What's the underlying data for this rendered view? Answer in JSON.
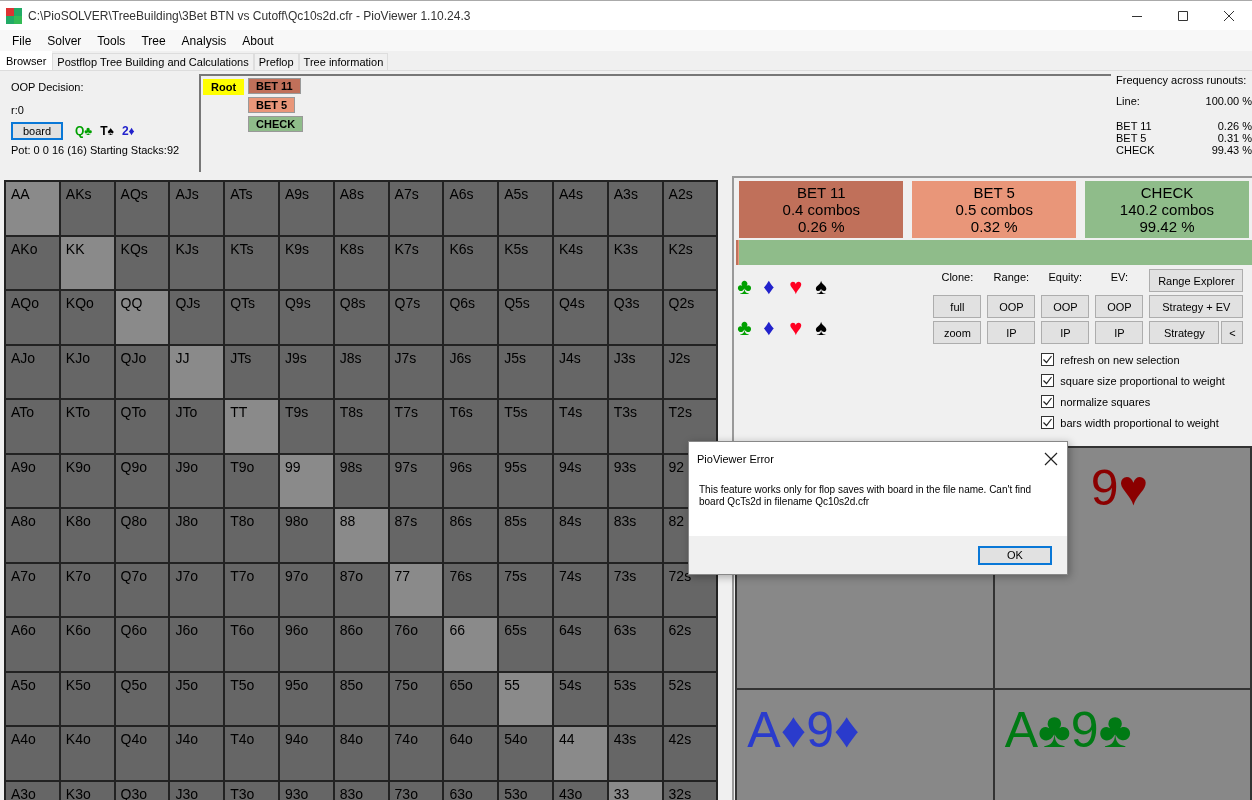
{
  "window": {
    "title": "C:\\PioSOLVER\\TreeBuilding\\3Bet BTN vs Cutoff\\Qc10s2d.cfr - PioViewer 1.10.24.3"
  },
  "menu": [
    "File",
    "Solver",
    "Tools",
    "Tree",
    "Analysis",
    "About"
  ],
  "tabs": [
    {
      "label": "Browser",
      "selected": true
    },
    {
      "label": "Postflop Tree Building and Calculations",
      "selected": false
    },
    {
      "label": "Preflop",
      "selected": false
    },
    {
      "label": "Tree information",
      "selected": false
    }
  ],
  "info": {
    "decision": "OOP Decision:",
    "node": "r:0",
    "board_button": "board",
    "board": [
      {
        "label": "Q♣",
        "color": "#00a000"
      },
      {
        "label": "T♠",
        "color": "#000000"
      },
      {
        "label": "2♦",
        "color": "#2222cc"
      }
    ],
    "pot": "Pot: 0 0 16 (16) Starting Stacks:92"
  },
  "tree": {
    "label": "Root",
    "color": "#ffff00",
    "children": [
      {
        "label": "BET 11",
        "color": "#c0705a"
      },
      {
        "label": "BET 5",
        "color": "#e99679"
      },
      {
        "label": "CHECK",
        "color": "#8fbc8a"
      }
    ]
  },
  "frequency": {
    "title": "Frequency across runouts:",
    "line_label": "Line:",
    "line_value": "100.00 %",
    "rows": [
      {
        "label": "BET 11",
        "value": "0.26 %"
      },
      {
        "label": "BET 5",
        "value": "0.31 %"
      },
      {
        "label": "CHECK",
        "value": "99.43 %"
      }
    ]
  },
  "grid": {
    "rows": [
      [
        {
          "label": "AA",
          "kind": "pair"
        },
        {
          "label": "AKs",
          "kind": "hand"
        },
        {
          "label": "AQs",
          "kind": "hand"
        },
        {
          "label": "AJs",
          "kind": "hand"
        },
        {
          "label": "ATs",
          "kind": "hand"
        },
        {
          "label": "A9s",
          "kind": "hand"
        },
        {
          "label": "A8s",
          "kind": "hand"
        },
        {
          "label": "A7s",
          "kind": "hand"
        },
        {
          "label": "A6s",
          "kind": "hand"
        },
        {
          "label": "A5s",
          "kind": "hand"
        },
        {
          "label": "A4s",
          "kind": "hand"
        },
        {
          "label": "A3s",
          "kind": "hand"
        },
        {
          "label": "A2s",
          "kind": "hand"
        }
      ],
      [
        {
          "label": "AKo",
          "kind": "hand"
        },
        {
          "label": "KK",
          "kind": "pair"
        },
        {
          "label": "KQs",
          "kind": "hand"
        },
        {
          "label": "KJs",
          "kind": "hand"
        },
        {
          "label": "KTs",
          "kind": "hand"
        },
        {
          "label": "K9s",
          "kind": "hand"
        },
        {
          "label": "K8s",
          "kind": "hand"
        },
        {
          "label": "K7s",
          "kind": "hand"
        },
        {
          "label": "K6s",
          "kind": "hand"
        },
        {
          "label": "K5s",
          "kind": "hand"
        },
        {
          "label": "K4s",
          "kind": "hand"
        },
        {
          "label": "K3s",
          "kind": "hand"
        },
        {
          "label": "K2s",
          "kind": "hand"
        }
      ],
      [
        {
          "label": "AQo",
          "kind": "hand"
        },
        {
          "label": "KQo",
          "kind": "hand"
        },
        {
          "label": "QQ",
          "kind": "pair"
        },
        {
          "label": "QJs",
          "kind": "hand"
        },
        {
          "label": "QTs",
          "kind": "hand"
        },
        {
          "label": "Q9s",
          "kind": "hand"
        },
        {
          "label": "Q8s",
          "kind": "hand"
        },
        {
          "label": "Q7s",
          "kind": "hand"
        },
        {
          "label": "Q6s",
          "kind": "hand"
        },
        {
          "label": "Q5s",
          "kind": "hand"
        },
        {
          "label": "Q4s",
          "kind": "hand"
        },
        {
          "label": "Q3s",
          "kind": "hand"
        },
        {
          "label": "Q2s",
          "kind": "hand"
        }
      ],
      [
        {
          "label": "AJo",
          "kind": "hand"
        },
        {
          "label": "KJo",
          "kind": "hand"
        },
        {
          "label": "QJo",
          "kind": "hand"
        },
        {
          "label": "JJ",
          "kind": "pair"
        },
        {
          "label": "JTs",
          "kind": "hand"
        },
        {
          "label": "J9s",
          "kind": "hand"
        },
        {
          "label": "J8s",
          "kind": "hand"
        },
        {
          "label": "J7s",
          "kind": "hand"
        },
        {
          "label": "J6s",
          "kind": "hand"
        },
        {
          "label": "J5s",
          "kind": "hand"
        },
        {
          "label": "J4s",
          "kind": "hand"
        },
        {
          "label": "J3s",
          "kind": "hand"
        },
        {
          "label": "J2s",
          "kind": "hand"
        }
      ],
      [
        {
          "label": "ATo",
          "kind": "hand"
        },
        {
          "label": "KTo",
          "kind": "hand"
        },
        {
          "label": "QTo",
          "kind": "hand"
        },
        {
          "label": "JTo",
          "kind": "hand"
        },
        {
          "label": "TT",
          "kind": "pair"
        },
        {
          "label": "T9s",
          "kind": "hand"
        },
        {
          "label": "T8s",
          "kind": "hand"
        },
        {
          "label": "T7s",
          "kind": "hand"
        },
        {
          "label": "T6s",
          "kind": "hand"
        },
        {
          "label": "T5s",
          "kind": "hand"
        },
        {
          "label": "T4s",
          "kind": "hand"
        },
        {
          "label": "T3s",
          "kind": "hand"
        },
        {
          "label": "T2s",
          "kind": "hand"
        }
      ],
      [
        {
          "label": "A9o",
          "kind": "hand"
        },
        {
          "label": "K9o",
          "kind": "hand"
        },
        {
          "label": "Q9o",
          "kind": "hand"
        },
        {
          "label": "J9o",
          "kind": "hand"
        },
        {
          "label": "T9o",
          "kind": "hand"
        },
        {
          "label": "99",
          "kind": "pair"
        },
        {
          "label": "98s",
          "kind": "hand"
        },
        {
          "label": "97s",
          "kind": "hand"
        },
        {
          "label": "96s",
          "kind": "hand"
        },
        {
          "label": "95s",
          "kind": "hand"
        },
        {
          "label": "94s",
          "kind": "hand"
        },
        {
          "label": "93s",
          "kind": "hand"
        },
        {
          "label": "92",
          "kind": "hand"
        }
      ],
      [
        {
          "label": "A8o",
          "kind": "hand"
        },
        {
          "label": "K8o",
          "kind": "hand"
        },
        {
          "label": "Q8o",
          "kind": "hand"
        },
        {
          "label": "J8o",
          "kind": "hand"
        },
        {
          "label": "T8o",
          "kind": "hand"
        },
        {
          "label": "98o",
          "kind": "hand"
        },
        {
          "label": "88",
          "kind": "pair"
        },
        {
          "label": "87s",
          "kind": "hand"
        },
        {
          "label": "86s",
          "kind": "hand"
        },
        {
          "label": "85s",
          "kind": "hand"
        },
        {
          "label": "84s",
          "kind": "hand"
        },
        {
          "label": "83s",
          "kind": "hand"
        },
        {
          "label": "82",
          "kind": "hand"
        }
      ],
      [
        {
          "label": "A7o",
          "kind": "hand"
        },
        {
          "label": "K7o",
          "kind": "hand"
        },
        {
          "label": "Q7o",
          "kind": "hand"
        },
        {
          "label": "J7o",
          "kind": "hand"
        },
        {
          "label": "T7o",
          "kind": "hand"
        },
        {
          "label": "97o",
          "kind": "hand"
        },
        {
          "label": "87o",
          "kind": "hand"
        },
        {
          "label": "77",
          "kind": "pair"
        },
        {
          "label": "76s",
          "kind": "hand"
        },
        {
          "label": "75s",
          "kind": "hand"
        },
        {
          "label": "74s",
          "kind": "hand"
        },
        {
          "label": "73s",
          "kind": "hand"
        },
        {
          "label": "72s",
          "kind": "hand"
        }
      ],
      [
        {
          "label": "A6o",
          "kind": "hand"
        },
        {
          "label": "K6o",
          "kind": "hand"
        },
        {
          "label": "Q6o",
          "kind": "hand"
        },
        {
          "label": "J6o",
          "kind": "hand"
        },
        {
          "label": "T6o",
          "kind": "hand"
        },
        {
          "label": "96o",
          "kind": "hand"
        },
        {
          "label": "86o",
          "kind": "hand"
        },
        {
          "label": "76o",
          "kind": "hand"
        },
        {
          "label": "66",
          "kind": "pair"
        },
        {
          "label": "65s",
          "kind": "hand"
        },
        {
          "label": "64s",
          "kind": "hand"
        },
        {
          "label": "63s",
          "kind": "hand"
        },
        {
          "label": "62s",
          "kind": "hand"
        }
      ],
      [
        {
          "label": "A5o",
          "kind": "hand"
        },
        {
          "label": "K5o",
          "kind": "hand"
        },
        {
          "label": "Q5o",
          "kind": "hand"
        },
        {
          "label": "J5o",
          "kind": "hand"
        },
        {
          "label": "T5o",
          "kind": "hand"
        },
        {
          "label": "95o",
          "kind": "hand"
        },
        {
          "label": "85o",
          "kind": "hand"
        },
        {
          "label": "75o",
          "kind": "hand"
        },
        {
          "label": "65o",
          "kind": "hand"
        },
        {
          "label": "55",
          "kind": "pair"
        },
        {
          "label": "54s",
          "kind": "hand"
        },
        {
          "label": "53s",
          "kind": "hand"
        },
        {
          "label": "52s",
          "kind": "hand"
        }
      ],
      [
        {
          "label": "A4o",
          "kind": "hand"
        },
        {
          "label": "K4o",
          "kind": "hand"
        },
        {
          "label": "Q4o",
          "kind": "hand"
        },
        {
          "label": "J4o",
          "kind": "hand"
        },
        {
          "label": "T4o",
          "kind": "hand"
        },
        {
          "label": "94o",
          "kind": "hand"
        },
        {
          "label": "84o",
          "kind": "hand"
        },
        {
          "label": "74o",
          "kind": "hand"
        },
        {
          "label": "64o",
          "kind": "hand"
        },
        {
          "label": "54o",
          "kind": "hand"
        },
        {
          "label": "44",
          "kind": "pair"
        },
        {
          "label": "43s",
          "kind": "hand"
        },
        {
          "label": "42s",
          "kind": "hand"
        }
      ],
      [
        {
          "label": "A3o",
          "kind": "hand"
        },
        {
          "label": "K3o",
          "kind": "hand"
        },
        {
          "label": "Q3o",
          "kind": "hand"
        },
        {
          "label": "J3o",
          "kind": "hand"
        },
        {
          "label": "T3o",
          "kind": "hand"
        },
        {
          "label": "93o",
          "kind": "hand"
        },
        {
          "label": "83o",
          "kind": "hand"
        },
        {
          "label": "73o",
          "kind": "hand"
        },
        {
          "label": "63o",
          "kind": "hand"
        },
        {
          "label": "53o",
          "kind": "hand"
        },
        {
          "label": "43o",
          "kind": "hand"
        },
        {
          "label": "33",
          "kind": "pair"
        },
        {
          "label": "32s",
          "kind": "hand"
        }
      ]
    ]
  },
  "actions": [
    {
      "name": "BET 11",
      "combos": "0.4 combos",
      "percent": "0.26 %",
      "color": "#c0705a",
      "level": 0.0026
    },
    {
      "name": "BET 5",
      "combos": "0.5 combos",
      "percent": "0.32 %",
      "color": "#e99679",
      "level": 0.0032
    },
    {
      "name": "CHECK",
      "combos": "140.2 combos",
      "percent": "99.42 %",
      "color": "#8fbc8a",
      "level": 0.9942
    }
  ],
  "suit_rows": [
    [
      {
        "label": "♣",
        "color": "#00a000"
      },
      {
        "label": "♦",
        "color": "#2222cc"
      },
      {
        "label": "♥",
        "color": "#ff0022"
      },
      {
        "label": "♠",
        "color": "#000000"
      }
    ],
    [
      {
        "label": "♣",
        "color": "#00a000"
      },
      {
        "label": "♦",
        "color": "#2222cc"
      },
      {
        "label": "♥",
        "color": "#ff0022"
      },
      {
        "label": "♠",
        "color": "#000000"
      }
    ]
  ],
  "controls": {
    "headers": [
      "Clone:",
      "Range:",
      "Equity:",
      "EV:"
    ],
    "range_explorer": "Range Explorer",
    "row_1": [
      "full",
      "OOP",
      "OOP",
      "OOP",
      "Strategy + EV"
    ],
    "row_2": [
      "zoom",
      "IP",
      "IP",
      "IP",
      "Strategy",
      "<"
    ]
  },
  "checkboxes": [
    {
      "label": "refresh on new selection",
      "checked": true
    },
    {
      "label": "square size proportional to weight",
      "checked": true
    },
    {
      "label": "normalize squares",
      "checked": true
    },
    {
      "label": "bars width proportional to weight",
      "checked": true
    }
  ],
  "hand_cards": [
    {
      "kind": "empty"
    },
    {
      "kind": "hand",
      "label": "9♥",
      "color": "#8b0000"
    },
    {
      "kind": "hand",
      "label": "A♦9♦",
      "color": "#2a3bcc"
    },
    {
      "kind": "hand",
      "label": "A♣9♣",
      "color": "#007a14"
    }
  ],
  "dialog": {
    "title": "PioViewer Error",
    "message": "This feature works only for flop saves with board in the file name. Can't find board QcTs2d in filename Qc10s2d.cfr",
    "button": "OK"
  }
}
